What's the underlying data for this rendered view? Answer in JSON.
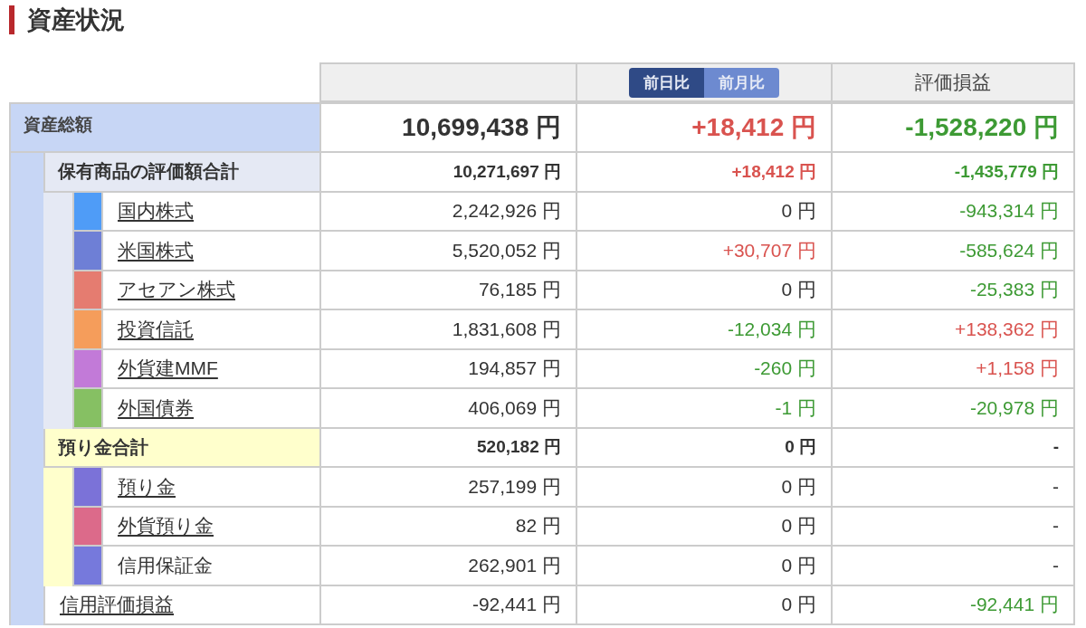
{
  "title": "資産状況",
  "header": {
    "toggle": [
      {
        "label": "前日比",
        "selected": true
      },
      {
        "label": "前月比",
        "selected": false
      }
    ],
    "pnl_header": "評価損益"
  },
  "total": {
    "label": "資産総額",
    "value": "10,699,438 円",
    "change": {
      "text": "+18,412 円",
      "kind": "gain"
    },
    "pnl": {
      "text": "-1,528,220 円",
      "kind": "loss"
    }
  },
  "groups": [
    {
      "kind": "holdings",
      "label": "保有商品の評価額合計",
      "value": "10,271,697 円",
      "change": {
        "text": "+18,412 円",
        "kind": "gain"
      },
      "pnl": {
        "text": "-1,435,779 円",
        "kind": "loss"
      },
      "items": [
        {
          "label": "国内株式",
          "link": true,
          "color": "#4f9cf7",
          "value": "2,242,926 円",
          "change": {
            "text": "0 円",
            "kind": "neutral"
          },
          "pnl": {
            "text": "-943,314 円",
            "kind": "loss"
          }
        },
        {
          "label": "米国株式",
          "link": true,
          "color": "#6e7fd6",
          "value": "5,520,052 円",
          "change": {
            "text": "+30,707 円",
            "kind": "gain"
          },
          "pnl": {
            "text": "-585,624 円",
            "kind": "loss"
          }
        },
        {
          "label": "アセアン株式",
          "link": true,
          "color": "#e57c70",
          "value": "76,185 円",
          "change": {
            "text": "0 円",
            "kind": "neutral"
          },
          "pnl": {
            "text": "-25,383 円",
            "kind": "loss"
          }
        },
        {
          "label": "投資信託",
          "link": true,
          "color": "#f59d5b",
          "value": "1,831,608 円",
          "change": {
            "text": "-12,034 円",
            "kind": "loss"
          },
          "pnl": {
            "text": "+138,362 円",
            "kind": "gain"
          }
        },
        {
          "label": "外貨建MMF",
          "link": true,
          "color": "#c27ad8",
          "value": "194,857 円",
          "change": {
            "text": "-260 円",
            "kind": "loss"
          },
          "pnl": {
            "text": "+1,158 円",
            "kind": "gain"
          }
        },
        {
          "label": "外国債券",
          "link": true,
          "color": "#86c063",
          "value": "406,069 円",
          "change": {
            "text": "-1 円",
            "kind": "loss"
          },
          "pnl": {
            "text": "-20,978 円",
            "kind": "loss"
          }
        }
      ]
    },
    {
      "kind": "deposits",
      "label": "預り金合計",
      "value": "520,182 円",
      "change": {
        "text": "0 円",
        "kind": "neutral"
      },
      "pnl": {
        "text": "-",
        "kind": "neutral"
      },
      "items": [
        {
          "label": "預り金",
          "link": true,
          "color": "#7b72d8",
          "value": "257,199 円",
          "change": {
            "text": "0 円",
            "kind": "neutral"
          },
          "pnl": {
            "text": "-",
            "kind": "neutral"
          }
        },
        {
          "label": "外貨預り金",
          "link": true,
          "color": "#dc6a8a",
          "value": "82 円",
          "change": {
            "text": "0 円",
            "kind": "neutral"
          },
          "pnl": {
            "text": "-",
            "kind": "neutral"
          }
        },
        {
          "label": "信用保証金",
          "link": false,
          "color": "#7679dc",
          "value": "262,901 円",
          "change": {
            "text": "0 円",
            "kind": "neutral"
          },
          "pnl": {
            "text": "-",
            "kind": "neutral"
          }
        }
      ]
    }
  ],
  "margin_row": {
    "label": "信用評価損益",
    "link": true,
    "value": "-92,441 円",
    "change": {
      "text": "0 円",
      "kind": "neutral"
    },
    "pnl": {
      "text": "-92,441 円",
      "kind": "loss"
    }
  }
}
